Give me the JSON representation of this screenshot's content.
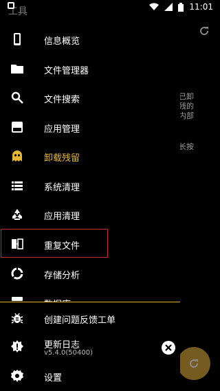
{
  "status_bar": {
    "time": "11:01"
  },
  "drawer": {
    "title": "工具",
    "items": [
      {
        "label": "信息概览",
        "icon": "phone-icon"
      },
      {
        "label": "文件管理器",
        "icon": "folder-icon"
      },
      {
        "label": "文件搜索",
        "icon": "search-icon"
      },
      {
        "label": "应用管理",
        "icon": "app-manager-icon"
      },
      {
        "label": "卸载残留",
        "icon": "ghost-icon"
      },
      {
        "label": "系统清理",
        "icon": "list-icon"
      },
      {
        "label": "应用清理",
        "icon": "recycle-icon"
      },
      {
        "label": "重复文件",
        "icon": "duplicate-file-icon"
      },
      {
        "label": "存储分析",
        "icon": "pie-chart-icon"
      },
      {
        "label": "数据库",
        "icon": "database-icon"
      }
    ],
    "footer": {
      "feedback_label": "创建问题反馈工单",
      "changelog_label": "更新日志",
      "version": "v5.4.0(50400)",
      "settings_label": "设置"
    }
  },
  "underlay": {
    "text_lines": [
      "已卸",
      "残的",
      "内部"
    ],
    "text2": "长按"
  },
  "colors": {
    "accent": "#e8b731",
    "highlight": "#c62828"
  }
}
